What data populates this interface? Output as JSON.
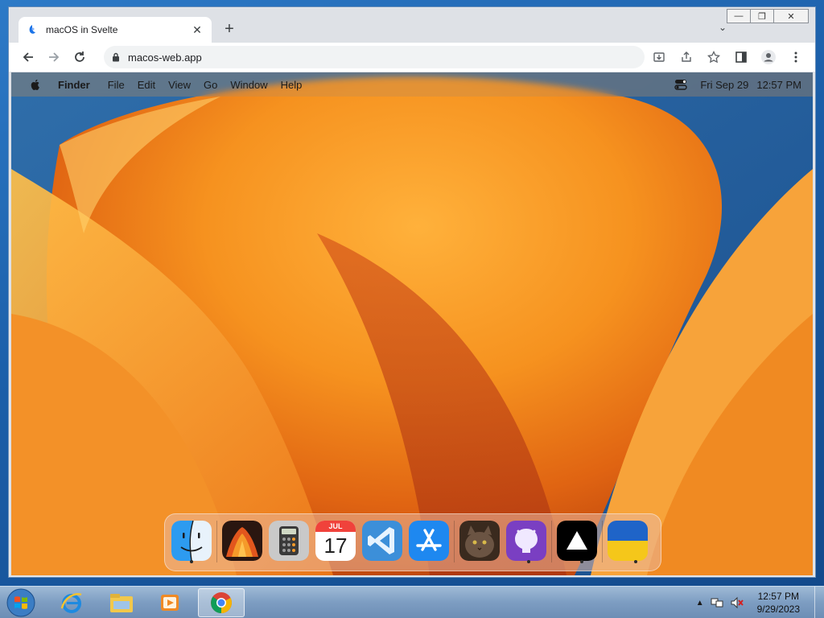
{
  "browser": {
    "tab_title": "macOS in Svelte",
    "url": "macos-web.app",
    "tab_close_glyph": "✕",
    "new_tab_glyph": "+",
    "tab_search_glyph": "⌄",
    "icons": [
      "back-arrow-icon",
      "forward-arrow-icon",
      "reload-icon",
      "lock-icon",
      "install-app-icon",
      "share-icon",
      "star-icon",
      "side-panel-icon",
      "profile-icon",
      "menu-dots-icon"
    ]
  },
  "window_controls": {
    "minimize": "—",
    "maximize": "❐",
    "close": "✕"
  },
  "menubar": {
    "app_name": "Finder",
    "items": [
      "File",
      "Edit",
      "View",
      "Go",
      "Window",
      "Help"
    ],
    "date": "Fri Sep 29",
    "time": "12:57 PM"
  },
  "dock": {
    "items": [
      {
        "name": "Finder",
        "icon": "finder-icon",
        "running": true
      },
      {
        "name": "Wallpapers",
        "icon": "wallpaper-icon",
        "running": false
      },
      {
        "name": "Calculator",
        "icon": "calculator-icon",
        "running": false
      },
      {
        "name": "Calendar",
        "icon": "calendar-icon",
        "running": false,
        "month": "JUL",
        "day": "17"
      },
      {
        "name": "VS Code",
        "icon": "vscode-icon",
        "running": false
      },
      {
        "name": "App Store",
        "icon": "app-store-icon",
        "running": false
      },
      {
        "name": "Photo",
        "icon": "cat-photo-icon",
        "running": false
      },
      {
        "name": "GitHub",
        "icon": "github-icon",
        "running": true
      },
      {
        "name": "Vercel",
        "icon": "vercel-icon",
        "running": true
      },
      {
        "name": "Ukraine",
        "icon": "ukraine-flag-icon",
        "running": true
      }
    ]
  },
  "taskbar": {
    "time": "12:57 PM",
    "date": "9/29/2023",
    "apps": [
      "ie-icon",
      "explorer-icon",
      "media-player-icon",
      "chrome-icon"
    ],
    "tray_arrow": "▲"
  },
  "colors": {
    "chrome_frame": "#dee1e6",
    "accent_blue": "#1b5ea8",
    "wallpaper_orange": "#f39a2a"
  }
}
